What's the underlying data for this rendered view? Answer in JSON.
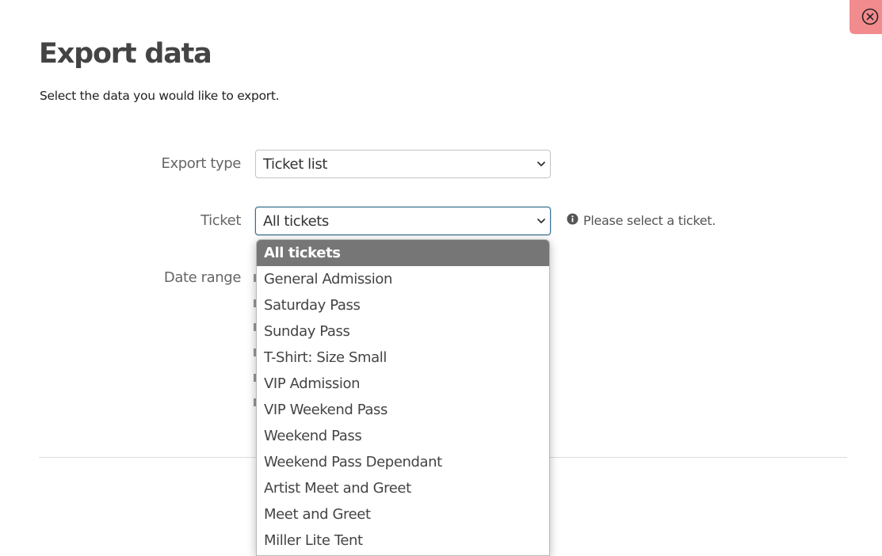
{
  "header": {
    "title": "Export data",
    "subtitle": "Select the data you would like to export."
  },
  "close_button": {
    "icon": "close-circle-icon",
    "color": "#f28b8e"
  },
  "form": {
    "export_type": {
      "label": "Export type",
      "value": "Ticket list"
    },
    "ticket": {
      "label": "Ticket",
      "value": "All tickets",
      "validation_icon": "info-icon",
      "validation_message": "Please select a ticket."
    },
    "date_range": {
      "label": "Date range"
    }
  },
  "ticket_dropdown": {
    "selected_index": 0,
    "options": [
      "All tickets",
      "General Admission",
      "Saturday Pass",
      "Sunday Pass",
      "T-Shirt: Size Small",
      "VIP Admission",
      "VIP Weekend Pass",
      "Weekend Pass",
      "Weekend Pass Dependant",
      "Artist Meet and Greet",
      "Meet and Greet",
      "Miller Lite Tent"
    ]
  },
  "colors": {
    "focus_border": "#3a6f8f",
    "selected_option_bg": "#767676"
  }
}
